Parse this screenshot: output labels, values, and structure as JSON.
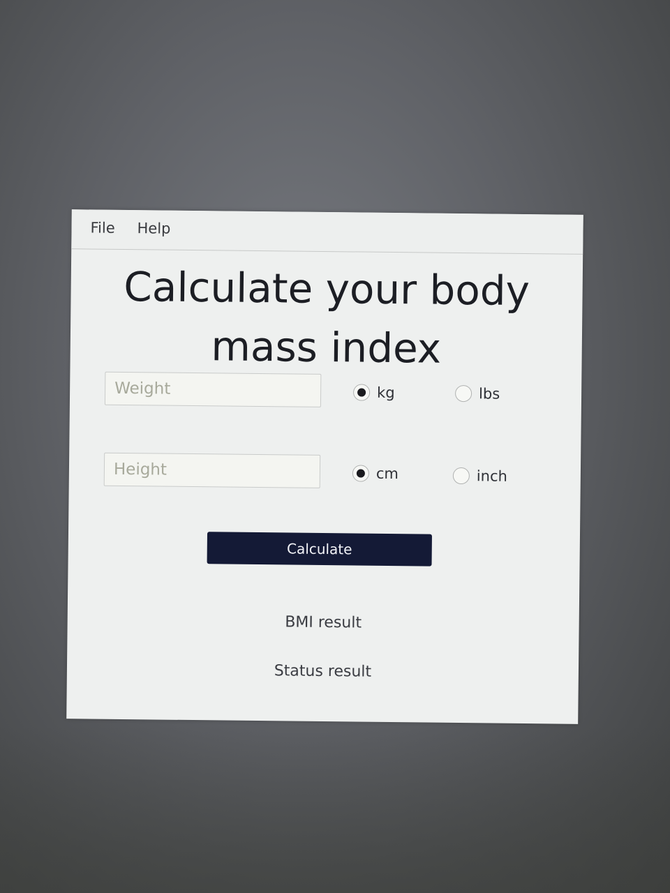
{
  "menu": {
    "items": [
      {
        "label": "File"
      },
      {
        "label": "Help"
      }
    ]
  },
  "title": "Calculate your body mass index",
  "weight": {
    "placeholder": "Weight",
    "value": "",
    "units": [
      {
        "label": "kg",
        "selected": true
      },
      {
        "label": "lbs",
        "selected": false
      }
    ]
  },
  "height": {
    "placeholder": "Height",
    "value": "",
    "units": [
      {
        "label": "cm",
        "selected": true
      },
      {
        "label": "inch",
        "selected": false
      }
    ]
  },
  "calculate_label": "Calculate",
  "results": {
    "bmi": "BMI result",
    "status": "Status result"
  },
  "colors": {
    "button_bg": "#141a36",
    "window_bg": "#eef0ef"
  }
}
